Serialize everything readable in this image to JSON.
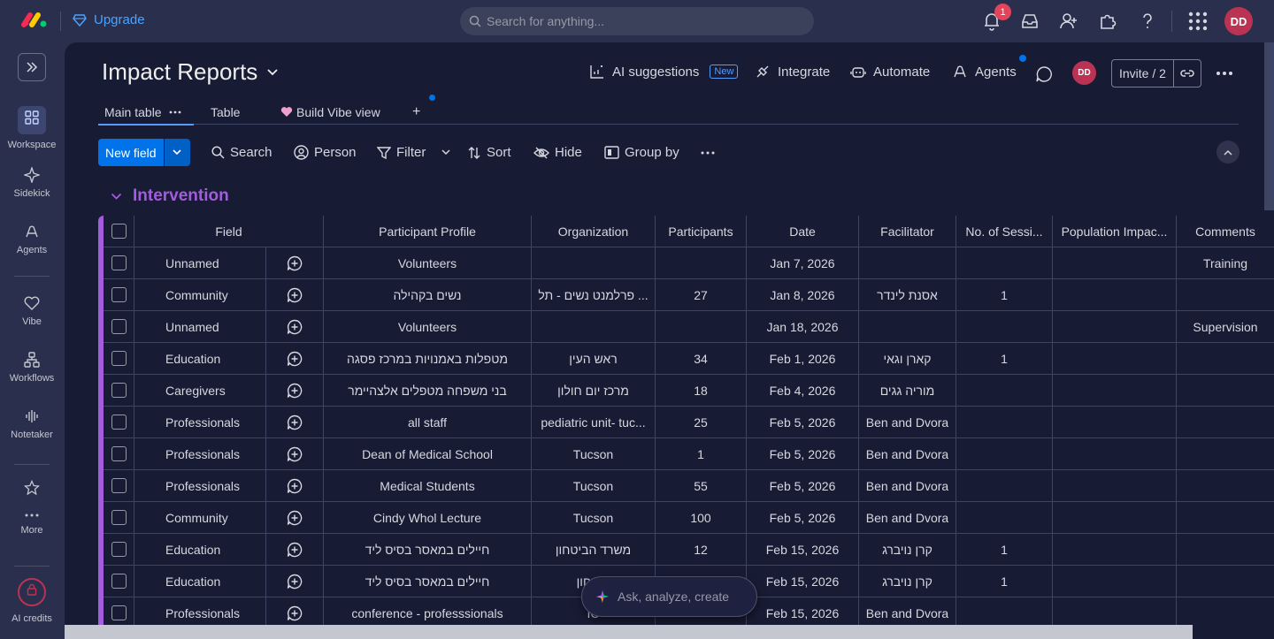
{
  "topbar": {
    "upgrade_label": "Upgrade",
    "search_placeholder": "Search for anything...",
    "notification_count": "1",
    "user_initials": "DD"
  },
  "rail": {
    "items": [
      {
        "label": "Workspace",
        "icon": "grid-icon"
      },
      {
        "label": "Sidekick",
        "icon": "sparkle-icon"
      },
      {
        "label": "Agents",
        "icon": "agent-icon"
      },
      {
        "label": "Vibe",
        "icon": "heart-icon"
      },
      {
        "label": "Workflows",
        "icon": "workflow-icon"
      },
      {
        "label": "Notetaker",
        "icon": "waveform-icon"
      },
      {
        "label": "More",
        "icon": "more-dots-icon"
      },
      {
        "label": "AI credits",
        "icon": "lock-icon"
      }
    ]
  },
  "board": {
    "title": "Impact Reports",
    "ai_suggestions": "AI suggestions",
    "new_badge": "New",
    "integrate": "Integrate",
    "automate": "Automate",
    "agents": "Agents",
    "owner_initials": "DD",
    "invite": "Invite / 2"
  },
  "views": {
    "tabs": [
      "Main table",
      "Table",
      "Build Vibe view"
    ],
    "add": "+"
  },
  "toolbar": {
    "new_field": "New field",
    "search": "Search",
    "person": "Person",
    "filter": "Filter",
    "sort": "Sort",
    "hide": "Hide",
    "group_by": "Group by"
  },
  "group": {
    "title": "Intervention",
    "color": "#a25ddc"
  },
  "table": {
    "columns": [
      "Field",
      "Participant Profile",
      "Organization",
      "Participants",
      "Date",
      "Facilitator",
      "No. of Sessi...",
      "Population Impac...",
      "Comments"
    ],
    "rows": [
      [
        "Unnamed",
        "Volunteers",
        "",
        "",
        "Jan 7, 2026",
        "",
        "",
        "",
        "Training"
      ],
      [
        "Community",
        "נשים בקהילה",
        "פרלמנט נשים - תל ...",
        "27",
        "Jan 8, 2026",
        "אסנת לינדר",
        "1",
        "",
        ""
      ],
      [
        "Unnamed",
        "Volunteers",
        "",
        "",
        "Jan 18, 2026",
        "",
        "",
        "",
        "Supervision"
      ],
      [
        "Education",
        "מטפלות באמנויות במרכז פסגה",
        "ראש העין",
        "34",
        "Feb 1, 2026",
        "קארן וגאי",
        "1",
        "",
        ""
      ],
      [
        "Caregivers",
        "בני משפחה מטפלים אלצהיימר",
        "מרכז יום חולון",
        "18",
        "Feb 4, 2026",
        "מוריה גגים",
        "",
        "",
        ""
      ],
      [
        "Professionals",
        "all staff",
        "pediatric unit- tuc...",
        "25",
        "Feb 5, 2026",
        "Ben and Dvora",
        "",
        "",
        ""
      ],
      [
        "Professionals",
        "Dean of Medical School",
        "Tucson",
        "1",
        "Feb 5, 2026",
        "Ben and Dvora",
        "",
        "",
        ""
      ],
      [
        "Professionals",
        "Medical Students",
        "Tucson",
        "55",
        "Feb 5, 2026",
        "Ben and Dvora",
        "",
        "",
        ""
      ],
      [
        "Community",
        "Cindy Whol Lecture",
        "Tucson",
        "100",
        "Feb 5, 2026",
        "Ben and Dvora",
        "",
        "",
        ""
      ],
      [
        "Education",
        "חיילים במאסר בסיס ליד",
        "משרד הביטחון",
        "12",
        "Feb 15, 2026",
        "קרן נויברג",
        "1",
        "",
        ""
      ],
      [
        "Education",
        "חיילים במאסר בסיס ליד",
        "ביטחון",
        "",
        "Feb 15, 2026",
        "קרן נויברג",
        "1",
        "",
        ""
      ],
      [
        "Professionals",
        "conference - professsionals",
        "IC",
        "",
        "Feb 15, 2026",
        "Ben and Dvora",
        "",
        "",
        ""
      ]
    ]
  },
  "ask_bar": {
    "placeholder": "Ask, analyze, create"
  }
}
